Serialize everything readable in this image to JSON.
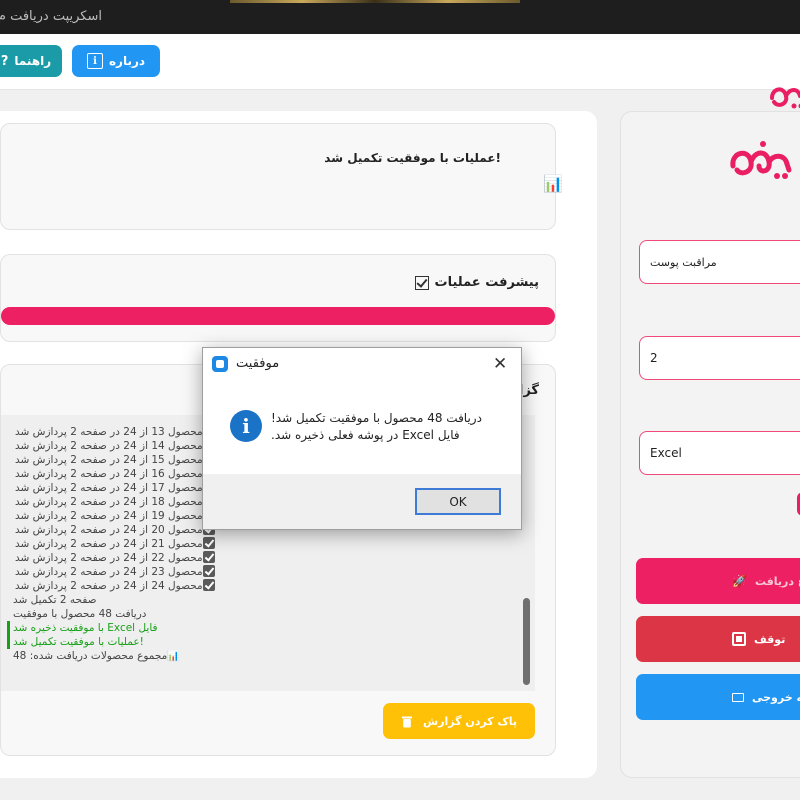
{
  "window": {
    "title": "اسکریپت دریافت م"
  },
  "header": {
    "about_label": "درباره",
    "about_icon": "info-icon",
    "help_label": "راهنما",
    "help_icon": "help-icon",
    "logo_text": "ی"
  },
  "status_card": {
    "message": "!عملیات با موفقیت تکمیل شد",
    "icon": "chart-icon"
  },
  "progress_card": {
    "title": "پیشرفت عملیات",
    "progress_percent": 100,
    "accent": "#ee2064"
  },
  "report_card": {
    "title": "گزارش",
    "log_lines": [
      {
        "text": "محصول 13 از 24 در صفحه 2 پردازش شد",
        "checked": true
      },
      {
        "text": "محصول 14 از 24 در صفحه 2 پردازش شد",
        "checked": true
      },
      {
        "text": "محصول 15 از 24 در صفحه 2 پردازش شد",
        "checked": true
      },
      {
        "text": "محصول 16 از 24 در صفحه 2 پردازش شد",
        "checked": true
      },
      {
        "text": "محصول 17 از 24 در صفحه 2 پردازش شد",
        "checked": true
      },
      {
        "text": "محصول 18 از 24 در صفحه 2 پردازش شد",
        "checked": true
      },
      {
        "text": "محصول 19 از 24 در صفحه 2 پردازش شد",
        "checked": true
      },
      {
        "text": "محصول 20 از 24 در صفحه 2 پردازش شد",
        "checked": true
      },
      {
        "text": "محصول 21 از 24 در صفحه 2 پردازش شد",
        "checked": true
      },
      {
        "text": "محصول 22 از 24 در صفحه 2 پردازش شد",
        "checked": true
      },
      {
        "text": "محصول 23 از 24 در صفحه 2 پردازش شد",
        "checked": true
      },
      {
        "text": "محصول 24 از 24 در صفحه 2 پردازش شد",
        "checked": true
      },
      {
        "text": "صفحه 2 تکمیل شد",
        "checked": false
      },
      {
        "text": "دریافت 48 محصول با موفقیت",
        "checked": false
      },
      {
        "text": "فایل Excel با موفقیت ذخیره شد",
        "checked": false,
        "status": "success"
      },
      {
        "text": "!عملیات با موفقیت تکمیل شد",
        "checked": false,
        "status": "success"
      },
      {
        "text": "مجموع محصولات دریافت شده: 48",
        "checked": false,
        "icon": "chart-icon"
      }
    ],
    "clear_label": "پاک کردن گزارش",
    "clear_icon": "trash-icon"
  },
  "sidebar": {
    "category_value": "مراقبت پوست",
    "pages_value": "2",
    "format_value": "Excel",
    "start_label": "شروع دریافت",
    "stop_label": "توقف",
    "output_label": "پوشه خروجی"
  },
  "dialog": {
    "title": "موفقیت",
    "message_line1": "دریافت 48 محصول با موفقیت تکمیل شد!",
    "message_line2": "فایل Excel در پوشه فعلی ذخیره شد.",
    "ok_label": "OK",
    "icon": "info-icon"
  },
  "colors": {
    "pink": "#ee2064",
    "red": "#dc3545",
    "blue": "#2196f3",
    "teal": "#1b9aa8",
    "yellow": "#ffc107",
    "green": "#18a018"
  }
}
